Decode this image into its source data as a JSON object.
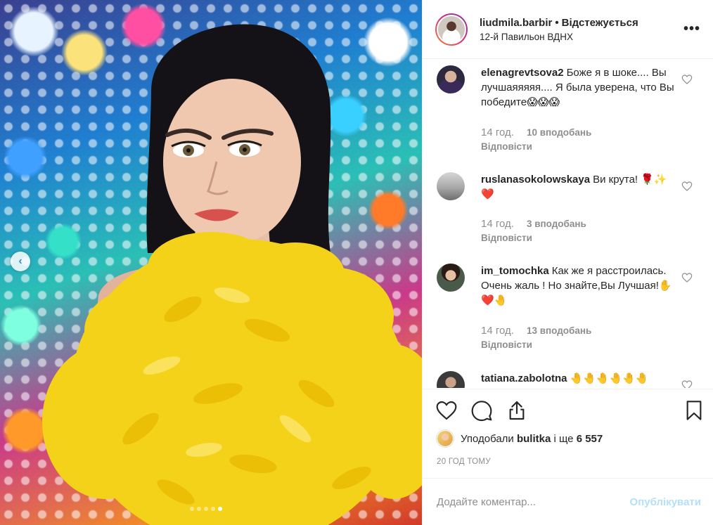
{
  "header": {
    "username": "liudmila.barbir",
    "separator": "•",
    "follow_status": "Відстежується",
    "location": "12-й Павильон ВДНХ",
    "more_icon": "more-horizontal-icon"
  },
  "carousel": {
    "total_slides": 5,
    "active_slide": 5
  },
  "comments": [
    {
      "username": "elenagrevtsova2",
      "text": "Боже я в шоке.... Вы лучшаяяяяя.... Я была уверена, что Вы победите😱😱😱",
      "time": "14 год.",
      "likes": "10 вподобань",
      "reply": "Відповісти"
    },
    {
      "username": "ruslanasokolowskaya",
      "text": "Ви крута! 🌹✨❤️",
      "time": "14 год.",
      "likes": "3 вподобань",
      "reply": "Відповісти"
    },
    {
      "username": "im_tomochka",
      "text": "Как же я расстроилась. Очень жаль ! Но знайте,Вы Лучшая!✋❤️🤚",
      "time": "14 год.",
      "likes": "13 вподобань",
      "reply": "Відповісти"
    },
    {
      "username": "tatiana.zabolotna",
      "text": "🤚🤚🤚🤚🤚🤚"
    }
  ],
  "actions": {
    "like_icon": "heart-icon",
    "comment_icon": "comment-icon",
    "share_icon": "share-icon",
    "save_icon": "bookmark-icon"
  },
  "likes": {
    "prefix": "Уподобали",
    "user": "bulitka",
    "middle": "і ще",
    "count": "6 557"
  },
  "timestamp": "20 ГОД ТОМУ",
  "add_comment": {
    "placeholder": "Додайте коментар...",
    "post_label": "Опублікувати"
  },
  "colors": {
    "text": "#262626",
    "muted": "#8e8e8e",
    "post_disabled": "#b2dffc",
    "border": "#efefef"
  }
}
